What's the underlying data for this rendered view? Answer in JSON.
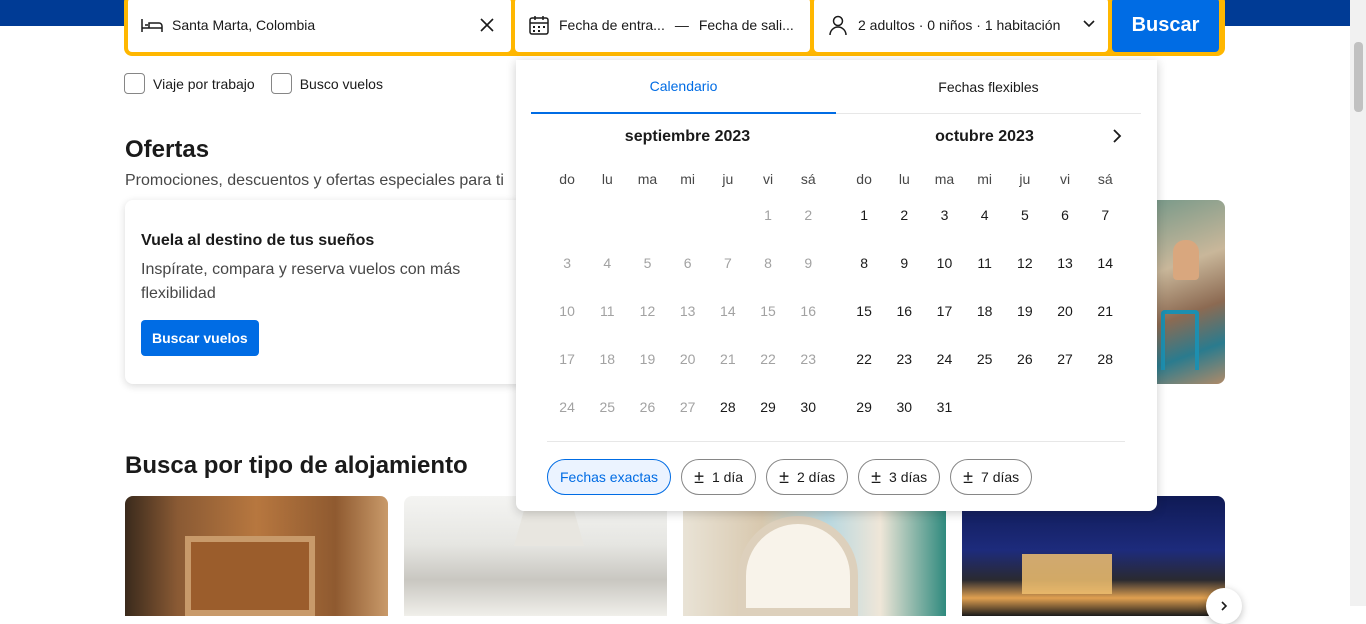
{
  "search": {
    "destination": "Santa Marta, Colombia",
    "checkin_placeholder": "Fecha de entra...",
    "separator": "—",
    "checkout_placeholder": "Fecha de sali...",
    "guests": "2 adultos · 0 niños · 1 habitación",
    "button": "Buscar"
  },
  "options": {
    "work_trip": "Viaje por trabajo",
    "flights": "Busco vuelos"
  },
  "offers": {
    "title": "Ofertas",
    "subtitle": "Promociones, descuentos y ofertas especiales para ti",
    "card_title": "Vuela al destino de tus sueños",
    "card_text": "Inspírate, compara y reserva vuelos con más flexibilidad",
    "card_button": "Buscar vuelos"
  },
  "types": {
    "title": "Busca por tipo de alojamiento"
  },
  "calendar": {
    "tabs": [
      "Calendario",
      "Fechas flexibles"
    ],
    "weekdays": [
      "do",
      "lu",
      "ma",
      "mi",
      "ju",
      "vi",
      "sá"
    ],
    "months": [
      {
        "title": "septiembre 2023",
        "offset": 5,
        "days": 30,
        "disabled_through": 27
      },
      {
        "title": "octubre 2023",
        "offset": 0,
        "days": 31,
        "disabled_through": 0
      }
    ],
    "chips": [
      {
        "label": "Fechas exactas",
        "selected": true,
        "plusminus": false
      },
      {
        "label": "1 día",
        "selected": false,
        "plusminus": true
      },
      {
        "label": "2 días",
        "selected": false,
        "plusminus": true
      },
      {
        "label": "3 días",
        "selected": false,
        "plusminus": true
      },
      {
        "label": "7 días",
        "selected": false,
        "plusminus": true
      }
    ]
  },
  "colors": {
    "brand_blue": "#003b95",
    "action_blue": "#006ce4",
    "search_border": "#ffb700"
  }
}
